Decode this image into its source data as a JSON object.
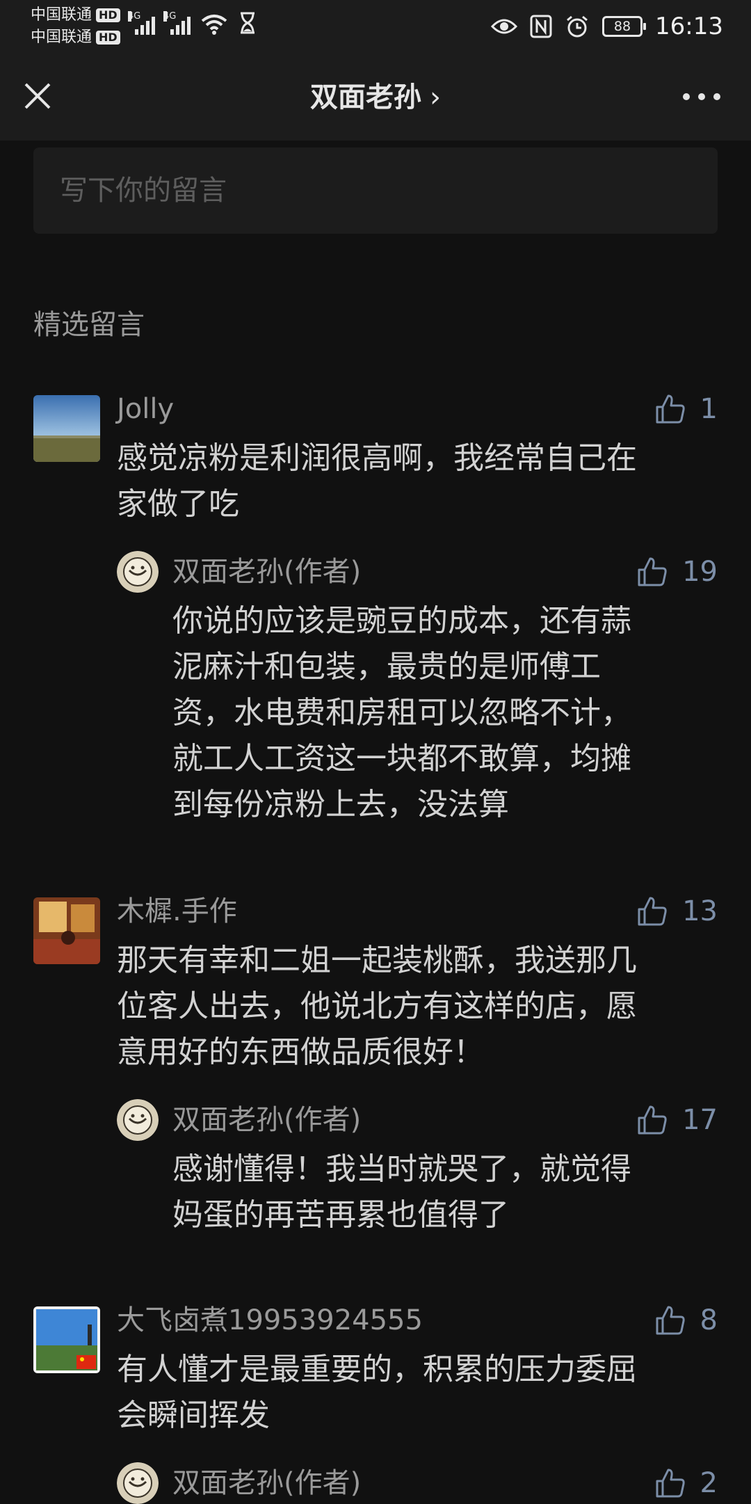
{
  "status_bar": {
    "carrier1": "中国联通",
    "carrier2": "中国联通",
    "hd_label": "HD",
    "network1": "4G",
    "network2": "4G",
    "battery": "88",
    "time": "16:13"
  },
  "nav": {
    "title": "双面老孙",
    "chevron": "›"
  },
  "comment_input": {
    "placeholder": "写下你的留言"
  },
  "section": {
    "title": "精选留言"
  },
  "comments": [
    {
      "name": "Jolly",
      "likes": "1",
      "text_lines": [
        "感觉凉粉是利润很高啊，我经常自己在",
        "家做了吃"
      ],
      "reply": {
        "name": "双面老孙(作者)",
        "likes": "19",
        "text_lines": [
          "你说的应该是豌豆的成本，还有蒜",
          "泥麻汁和包装，最贵的是师傅工",
          "资，水电费和房租可以忽略不计，",
          "就工人工资这一块都不敢算，均摊",
          "到每份凉粉上去，没法算"
        ]
      }
    },
    {
      "name": "木樨.手作",
      "likes": "13",
      "text_lines": [
        "那天有幸和二姐一起装桃酥，我送那几",
        "位客人出去，他说北方有这样的店，愿",
        "意用好的东西做品质很好！"
      ],
      "reply": {
        "name": "双面老孙(作者)",
        "likes": "17",
        "text_lines": [
          "感谢懂得！我当时就哭了，就觉得",
          "妈蛋的再苦再累也值得了"
        ]
      }
    },
    {
      "name": "大飞卤煮19953924555",
      "likes": "8",
      "text_lines": [
        "有人懂才是最重要的，积累的压力委屈",
        "会瞬间挥发"
      ],
      "reply": {
        "name": "双面老孙(作者)",
        "likes": "2",
        "text_lines": []
      }
    }
  ],
  "colors": {
    "background": "#111111",
    "bar": "#1c1c1c",
    "like_blue": "#7c8ea8"
  }
}
